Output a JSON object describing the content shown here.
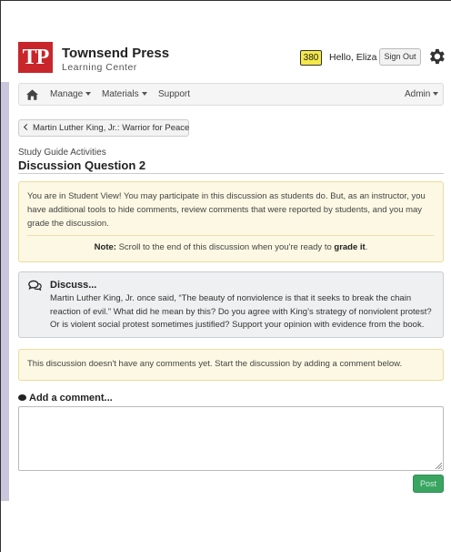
{
  "brand": {
    "logo_text": "TP",
    "name": "Townsend Press",
    "subtitle": "Learning Center"
  },
  "user": {
    "points": "380",
    "greeting": "Hello, Eliza",
    "signout_label": "Sign Out"
  },
  "nav": {
    "items": [
      {
        "label": "Manage",
        "dropdown": true
      },
      {
        "label": "Materials",
        "dropdown": true
      },
      {
        "label": "Support",
        "dropdown": false
      }
    ],
    "right_item": {
      "label": "Admin",
      "dropdown": true
    }
  },
  "back_button": {
    "label": "Martin Luther King, Jr.: Warrior for Peace"
  },
  "page": {
    "section_label": "Study Guide Activities",
    "title": "Discussion Question 2"
  },
  "student_view_notice": {
    "text": "You are in Student View! You may participate in this discussion as students do. But, as an instructor, you have additional tools to hide comments, review comments that were reported by students, and you may grade the discussion.",
    "note_label": "Note:",
    "note_text": " Scroll to the end of this discussion when you're ready to ",
    "note_bold": "grade it",
    "note_end": "."
  },
  "discussion": {
    "heading": "Discuss...",
    "prompt": "Martin Luther King, Jr. once said, “The beauty of nonviolence is that it seeks to break the chain reaction of evil.” What did he mean by this? Do you agree with King’s strategy of nonviolent protest? Or is violent social protest sometimes justified? Support your opinion with evidence from the book."
  },
  "empty_notice": "This discussion doesn't have any comments yet. Start the discussion by adding a comment below.",
  "comment_form": {
    "heading": "Add a comment...",
    "value": "",
    "post_label": "Post"
  },
  "colors": {
    "logo_red": "#c8262b",
    "points_badge": "#f5e84a",
    "notice_bg": "#fcf8e3",
    "discuss_bg": "#eef0f1",
    "post_green": "#3aa561"
  },
  "icons": [
    "home-icon",
    "gear-icon",
    "chevron-left-icon",
    "comments-icon",
    "comment-icon",
    "caret-down-icon"
  ]
}
